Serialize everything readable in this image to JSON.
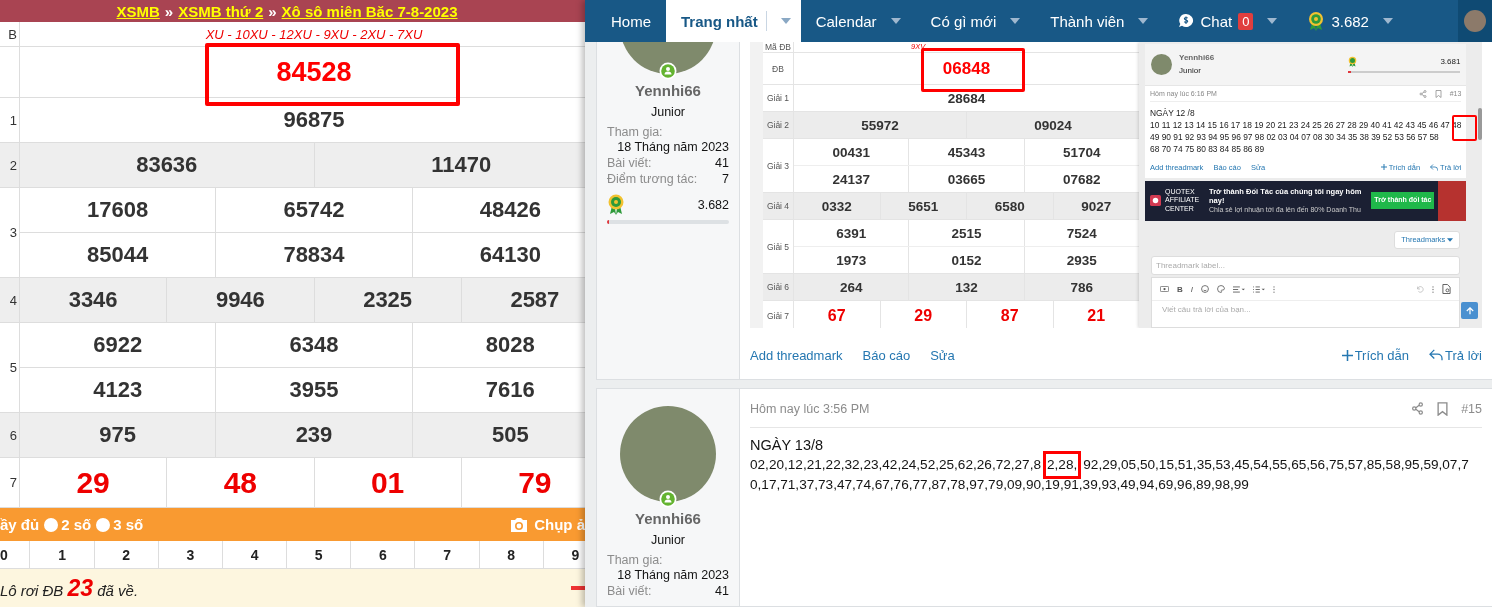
{
  "lottery_page": {
    "breadcrumb": [
      "XSMB",
      "XSMB thứ 2",
      "Xô sô miên Băc 7-8-2023"
    ],
    "separators": [
      "»",
      "»"
    ],
    "rows": [
      {
        "kind": "code",
        "label": "B",
        "lines": [
          [
            "XU - 10XU - 12XU - 9XU - 2XU - 7XU"
          ]
        ]
      },
      {
        "kind": "special",
        "highlighted": true,
        "lines": [
          [
            "84528"
          ]
        ]
      },
      {
        "kind": "prize",
        "label": "1",
        "lines": [
          [
            "96875"
          ]
        ]
      },
      {
        "kind": "prize",
        "label": "2",
        "lines": [
          [
            "83636",
            "11470"
          ]
        ]
      },
      {
        "kind": "prize",
        "label": "3",
        "lines": [
          [
            "17608",
            "65742",
            "48426"
          ],
          [
            "85044",
            "78834",
            "64130"
          ]
        ]
      },
      {
        "kind": "prize",
        "label": "4",
        "lines": [
          [
            "3346",
            "9946",
            "2325",
            "2587"
          ]
        ]
      },
      {
        "kind": "prize",
        "label": "5",
        "lines": [
          [
            "6922",
            "6348",
            "8028"
          ],
          [
            "4123",
            "3955",
            "7616"
          ]
        ]
      },
      {
        "kind": "prize",
        "label": "6",
        "lines": [
          [
            "975",
            "239",
            "505"
          ]
        ]
      },
      {
        "kind": "tail",
        "label": "7",
        "lines": [
          [
            "29",
            "48",
            "01",
            "79"
          ]
        ]
      }
    ],
    "options_bar": {
      "lead": "ầy đủ",
      "radios": [
        {
          "label": "2 số",
          "selected": false
        },
        {
          "label": "3 số",
          "selected": false
        }
      ],
      "capture": "Chụp ả"
    },
    "digits": [
      "0",
      "1",
      "2",
      "3",
      "4",
      "5",
      "6",
      "7",
      "8",
      "9"
    ],
    "notice": {
      "prefix": "Lô rơi ĐB",
      "number": "23",
      "suffix": "đã về."
    }
  },
  "forum": {
    "nav": [
      {
        "kind": "link",
        "label": "Home",
        "selected": false,
        "caret": false
      },
      {
        "kind": "link",
        "label": "Trang nhất",
        "selected": true,
        "caret": true
      },
      {
        "kind": "link",
        "label": "Calendar",
        "selected": false,
        "caret": true
      },
      {
        "kind": "link",
        "label": "Có gì mới",
        "selected": false,
        "caret": true
      },
      {
        "kind": "link",
        "label": "Thành viên",
        "selected": false,
        "caret": true
      },
      {
        "kind": "chat",
        "label": "Chat",
        "badge": "0",
        "selected": false,
        "caret": true
      },
      {
        "kind": "points",
        "label": "3.682",
        "selected": false,
        "caret": true
      }
    ],
    "posts": [
      {
        "user": {
          "name": "Yennhi66",
          "title": "Junior",
          "joined_label": "Tham gia:",
          "joined": "18 Tháng năm 2023",
          "stats": [
            {
              "label": "Bài viết:",
              "value": "41"
            },
            {
              "label": "Điểm tương tác:",
              "value": "7"
            }
          ],
          "points": "3.682",
          "level": 0.02
        },
        "embedded_screenshot": {
          "table": {
            "rows": [
              {
                "kind": "code",
                "label": "Mã ĐB",
                "lines": [
                  [
                    "9XV"
                  ]
                ]
              },
              {
                "kind": "special",
                "label": "ĐB",
                "highlighted": true,
                "lines": [
                  [
                    "06848"
                  ]
                ]
              },
              {
                "kind": "prize",
                "label": "Giải 1",
                "lines": [
                  [
                    "28684"
                  ]
                ]
              },
              {
                "kind": "prize",
                "label": "Giải 2",
                "lines": [
                  [
                    "55972",
                    "09024"
                  ]
                ]
              },
              {
                "kind": "prize",
                "label": "Giải 3",
                "lines": [
                  [
                    "00431",
                    "45343",
                    "51704"
                  ],
                  [
                    "24137",
                    "03665",
                    "07682"
                  ]
                ]
              },
              {
                "kind": "prize",
                "label": "Giải 4",
                "lines": [
                  [
                    "0332",
                    "5651",
                    "6580",
                    "9027"
                  ]
                ]
              },
              {
                "kind": "prize",
                "label": "Giải 5",
                "lines": [
                  [
                    "6391",
                    "2515",
                    "7524"
                  ],
                  [
                    "1973",
                    "0152",
                    "2935"
                  ]
                ]
              },
              {
                "kind": "prize",
                "label": "Giải 6",
                "lines": [
                  [
                    "264",
                    "132",
                    "786"
                  ]
                ]
              },
              {
                "kind": "tail",
                "label": "Giải 7",
                "lines": [
                  [
                    "67",
                    "29",
                    "87",
                    "21"
                  ]
                ]
              }
            ]
          },
          "thread_preview": {
            "user": {
              "name": "Yennhi66",
              "title": "Junior",
              "points": "3.681",
              "level": 0.02
            },
            "date": "Hôm nay lúc 6:16 PM",
            "number": "#13",
            "highlight": true,
            "body_lines": [
              "NGÀY 12 /8",
              "10 11 12 13 14 15 16 17 18 19 20 21 23 24 25 26 27 28 29 40 41 42 43 45 46 47 48",
              "49 90 91 92 93 94 95 96 97 98 02 03 04 07 08 30 34 35 38 39 52 53 56 57 58",
              "68 70 74 75 80 83 84 85 86 89"
            ],
            "actions": [
              {
                "kind": "plain",
                "label": "Add threadmark"
              },
              {
                "kind": "plain",
                "label": "Báo cáo"
              },
              {
                "kind": "plain",
                "label": "Sửa"
              },
              {
                "kind": "quote",
                "label": "Trích dẫn"
              },
              {
                "kind": "reply",
                "label": "Trả lời"
              }
            ],
            "ad": {
              "brand": "QUOTEX",
              "brand_sub": "AFFILIATE CENTER",
              "headline": "Trở thành Đối Tác của chúng tôi ngay hôm nay!",
              "subline": "Chia sẻ lợi nhuận tới đa lên đến 80% Doanh Thu",
              "button": "Trở thành đối tác"
            },
            "threadmarks_button": "Threadmarks",
            "label_field": {
              "placeholder": "Threadmark label..."
            },
            "toolbar": {
              "bold": "B",
              "italic": "I"
            },
            "reply_field": {
              "placeholder": "Viết câu trả lời của bạn..."
            }
          }
        },
        "actions": [
          {
            "kind": "plain",
            "label": "Add threadmark"
          },
          {
            "kind": "plain",
            "label": "Báo cáo"
          },
          {
            "kind": "plain",
            "label": "Sửa"
          },
          {
            "kind": "quote",
            "label": "Trích dẫn"
          },
          {
            "kind": "reply",
            "label": "Trả lời"
          }
        ]
      },
      {
        "user": {
          "name": "Yennhi66",
          "title": "Junior",
          "joined_label": "Tham gia:",
          "joined": "18 Tháng năm 2023",
          "stats": [
            {
              "label": "Bài viết:",
              "value": "41"
            }
          ]
        },
        "date": "Hôm nay lúc 3:56 PM",
        "number": "#15",
        "body_lines": [
          {
            "text": "NGÀY 13/8"
          },
          {
            "text": "02,20,12,21,22,32,23,42,24,52,25,62,26,72,27,8",
            "marked": "2,28,",
            "rest": "92,29,05,50,15,51,35,53,45,54,55,65,56,75,57,85,58,95,59,07,7"
          },
          {
            "text": "0,17,71,37,73,47,74,67,76,77,87,78,97,79,09,90,19,91,39,93,49,94,69,96,89,98,99"
          }
        ]
      }
    ]
  }
}
